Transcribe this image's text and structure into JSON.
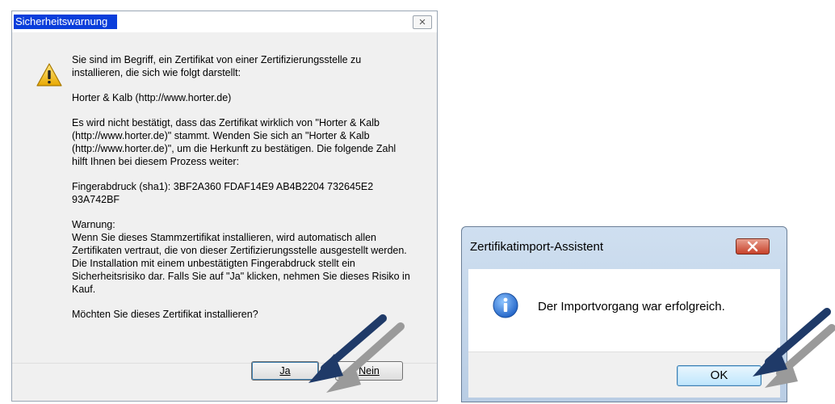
{
  "security_dialog": {
    "title": "Sicherheitswarnung",
    "close_symbol": "×",
    "icon": "warning-icon",
    "paragraphs": [
      "Sie sind im Begriff, ein Zertifikat von einer Zertifizierungsstelle zu installieren, die sich wie folgt darstellt:",
      "Horter & Kalb (http://www.horter.de)",
      "Es wird nicht bestätigt, dass das Zertifikat wirklich von \"Horter & Kalb (http://www.horter.de)\" stammt. Wenden Sie sich an \"Horter & Kalb (http://www.horter.de)\", um die Herkunft zu bestätigen. Die folgende Zahl hilft Ihnen bei diesem Prozess weiter:",
      "Fingerabdruck (sha1): 3BF2A360 FDAF14E9 AB4B2204 732645E2 93A742BF"
    ],
    "warning_heading": "Warnung:",
    "warning_text": "Wenn Sie dieses Stammzertifikat installieren, wird automatisch allen Zertifikaten vertraut, die von dieser Zertifizierungsstelle ausgestellt werden. Die Installation mit einem unbestätigten Fingerabdruck stellt ein Sicherheitsrisiko dar. Falls Sie auf \"Ja\" klicken, nehmen Sie dieses Risiko in Kauf.",
    "question": "Möchten Sie dieses Zertifikat installieren?",
    "yes_label": "Ja",
    "no_label": "Nein"
  },
  "import_dialog": {
    "title": "Zertifikatimport-Assistent",
    "icon": "info-icon",
    "message": "Der Importvorgang war erfolgreich.",
    "ok_label": "OK"
  },
  "colors": {
    "title_highlight": "#0a3edb",
    "arrow_dark": "#1f3a68",
    "arrow_gray": "#9a9a9a",
    "close_red": "#c7412a"
  }
}
